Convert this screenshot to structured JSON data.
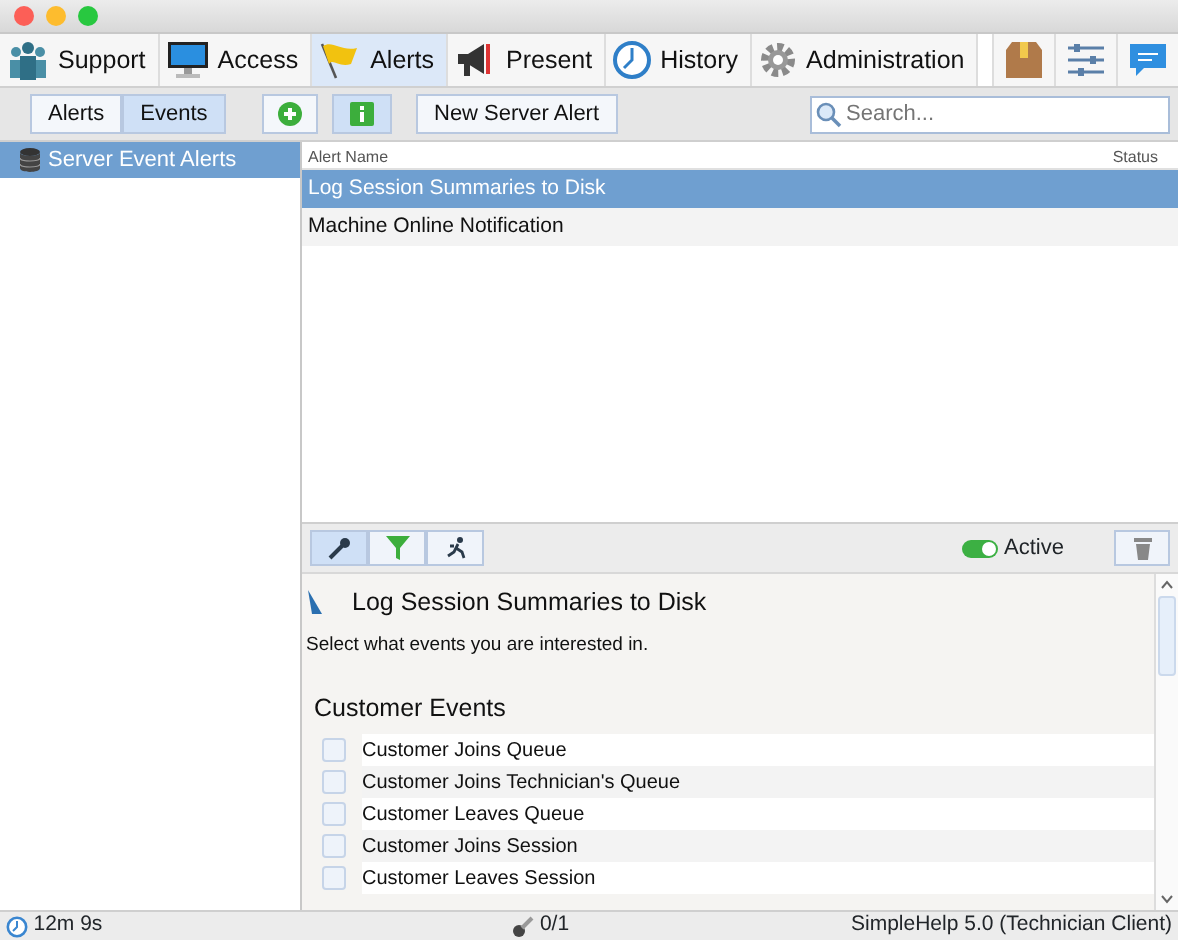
{
  "main_tabs": [
    {
      "label": "Support",
      "selected": false
    },
    {
      "label": "Access",
      "selected": false
    },
    {
      "label": "Alerts",
      "selected": true
    },
    {
      "label": "Present",
      "selected": false
    },
    {
      "label": "History",
      "selected": false
    },
    {
      "label": "Administration",
      "selected": false
    }
  ],
  "view_toggle": [
    {
      "label": "Alerts",
      "selected": false
    },
    {
      "label": "Events",
      "selected": true
    }
  ],
  "info_pressed": true,
  "new_button": "New Server Alert",
  "search": {
    "placeholder": "Search..."
  },
  "tree": [
    {
      "label": "Server Event Alerts",
      "selected": true
    }
  ],
  "table": {
    "columns": [
      "Alert Name",
      "Status"
    ],
    "rows": [
      {
        "name": "Log Session Summaries to Disk",
        "selected": true
      },
      {
        "name": "Machine Online Notification",
        "selected": false
      }
    ]
  },
  "detail_tools": [
    {
      "selected": true
    },
    {
      "selected": false
    },
    {
      "selected": false
    }
  ],
  "active": {
    "label": "Active",
    "on": true
  },
  "detail": {
    "title": "Log Session Summaries to Disk",
    "instruction": "Select what events you are interested in.",
    "groups": [
      {
        "heading": "Customer Events",
        "events": [
          {
            "label": "Customer Joins Queue",
            "checked": false
          },
          {
            "label": "Customer Joins Technician's Queue",
            "checked": false
          },
          {
            "label": "Customer Leaves Queue",
            "checked": false
          },
          {
            "label": "Customer Joins Session",
            "checked": false
          },
          {
            "label": "Customer Leaves Session",
            "checked": false
          }
        ]
      }
    ]
  },
  "status_bar": {
    "timer": "12m 9s",
    "sessions": "0/1",
    "version": "SimpleHelp 5.0 (Technician Client)"
  }
}
